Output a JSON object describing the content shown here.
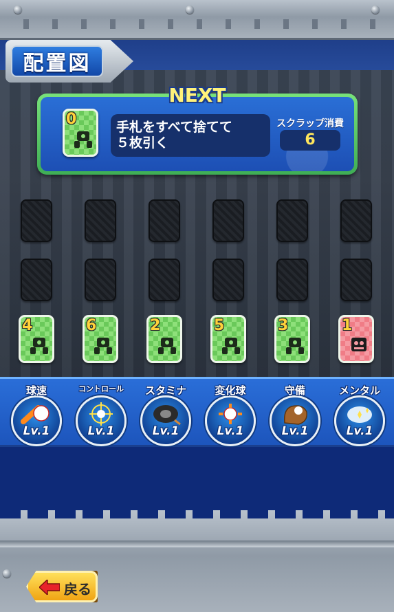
{
  "screen": {
    "title": "配置図"
  },
  "next": {
    "label": "NEXT",
    "card_number": "0",
    "effect_line1": "手札をすべて捨てて",
    "effect_line2": "５枚引く",
    "scrap_label": "スクラップ消費",
    "scrap_value": "6"
  },
  "slots": {
    "rows": 2,
    "columns": 6
  },
  "cards": [
    {
      "number": "4",
      "color": "green"
    },
    {
      "number": "6",
      "color": "green"
    },
    {
      "number": "2",
      "color": "green"
    },
    {
      "number": "5",
      "color": "green"
    },
    {
      "number": "3",
      "color": "green"
    },
    {
      "number": "1",
      "color": "red"
    }
  ],
  "stats": [
    {
      "name": "球速",
      "level": "Lv.1",
      "icon": "fast-ball-icon"
    },
    {
      "name": "コントロール",
      "level": "Lv.1",
      "icon": "crosshair-ball-icon"
    },
    {
      "name": "スタミナ",
      "level": "Lv.1",
      "icon": "tire-icon"
    },
    {
      "name": "変化球",
      "level": "Lv.1",
      "icon": "breaking-ball-icon"
    },
    {
      "name": "守備",
      "level": "Lv.1",
      "icon": "glove-icon"
    },
    {
      "name": "メンタル",
      "level": "Lv.1",
      "icon": "sparkle-heart-icon"
    }
  ],
  "footer": {
    "back_label": "戻る"
  },
  "colors": {
    "panel_blue": "#1d4fb4",
    "panel_border_green": "#3fae55",
    "next_label_yellow": "#fff27a",
    "card_green": "#6ac95a",
    "card_red": "#f07c86",
    "stat_bar_blue": "#2a6ed8",
    "back_button_yellow": "#f0a414"
  }
}
